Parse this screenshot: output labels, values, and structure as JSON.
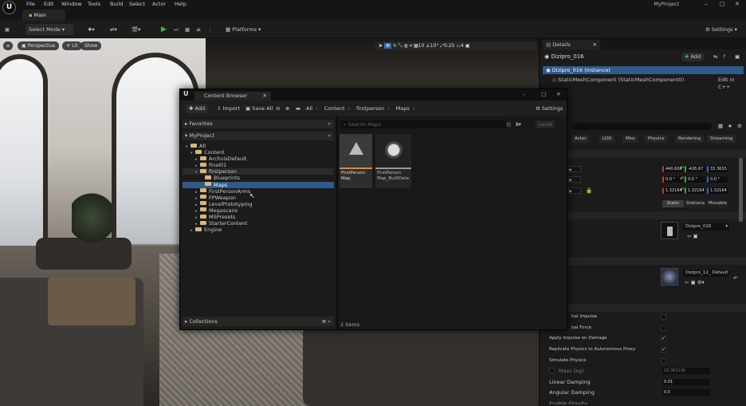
{
  "menubar": {
    "items": [
      "File",
      "Edit",
      "Window",
      "Tools",
      "Build",
      "Select",
      "Actor",
      "Help"
    ],
    "project": "MyProject"
  },
  "tabs": {
    "main": "Main"
  },
  "toolbar": {
    "select_mode": "Select Mode",
    "platforms": "Platforms",
    "settings": "Settings"
  },
  "viewport": {
    "perspective": "Perspective",
    "lit": "Lit",
    "show": "Show",
    "grid": "10",
    "angle": "10°",
    "scale": "0.25",
    "camera": "4"
  },
  "content_browser": {
    "title": "Content Browser",
    "add": "Add",
    "import": "Import",
    "save_all": "Save All",
    "settings": "Settings",
    "breadcrumb": [
      "All",
      "Content",
      "firstperson",
      "Maps"
    ],
    "favorites": "Favorites",
    "project": "MyProject",
    "tree": [
      {
        "label": "All",
        "depth": 0,
        "open": true
      },
      {
        "label": "Content",
        "depth": 1,
        "open": true
      },
      {
        "label": "ArchvisDefault",
        "depth": 2
      },
      {
        "label": "final01",
        "depth": 2
      },
      {
        "label": "firstperson",
        "depth": 2,
        "open": true
      },
      {
        "label": "Blueprints",
        "depth": 3
      },
      {
        "label": "Maps",
        "depth": 3,
        "selected": true
      },
      {
        "label": "FirstPersonArms",
        "depth": 2
      },
      {
        "label": "FPWeapon",
        "depth": 2
      },
      {
        "label": "LevelPrototyping",
        "depth": 2
      },
      {
        "label": "Megascans",
        "depth": 2
      },
      {
        "label": "MSPresets",
        "depth": 2
      },
      {
        "label": "StarterContent",
        "depth": 2
      },
      {
        "label": "Engine",
        "depth": 1
      }
    ],
    "search_placeholder": "Search Maps",
    "level_filter": "Level",
    "assets": [
      {
        "name": "FirstPerson Map",
        "type": "level"
      },
      {
        "name": "FirstPerson Map_BuiltData",
        "type": "data"
      }
    ],
    "collections": "Collections",
    "count": "2 items"
  },
  "details": {
    "tab": "Details",
    "object": "Dizipro_016",
    "add": "Add",
    "instance": "Dizipro_016 (Instance)",
    "component": "StaticMeshComponent (StaticMeshComponent0)",
    "edit_cpp": "Edit in C++",
    "filters": [
      "Actor",
      "LOD",
      "Misc",
      "Physics",
      "Rendering",
      "Streaming"
    ],
    "location": [
      "440.606",
      "-426.67",
      "33.3633"
    ],
    "rotation": [
      "0.0 °",
      "0.0 °",
      "0.0 °"
    ],
    "scale": [
      "1.32164",
      "1.32164",
      "1.32164"
    ],
    "mobility": [
      "Static",
      "Stationa",
      "Movable"
    ],
    "section_mesh": "sh",
    "mesh_label": "h",
    "mesh_value": "Dizipro_016",
    "material_value": "Dizipro_12_ Default",
    "physics": [
      {
        "label": "tial Impulse",
        "checked": false
      },
      {
        "label": "bal Force",
        "checked": false
      },
      {
        "label": "Apply Impulse on Damage",
        "checked": true
      },
      {
        "label": "Replicate Physics to Autonomous Proxy",
        "checked": true
      },
      {
        "label": "Simulate Physics",
        "checked": false
      }
    ],
    "mass_label": "Mass (kg)",
    "mass_value": "18.363136",
    "linear_damping_label": "Linear Damping",
    "linear_damping_value": "0.01",
    "angular_damping_label": "Angular Damping",
    "angular_damping_value": "0.0",
    "enable_gravity_label": "Enable Gravity"
  },
  "colors": {
    "accent_blue": "#2f6fb6",
    "selected_row": "#2f5a8a",
    "highlight_orange": "#e08a2f"
  }
}
